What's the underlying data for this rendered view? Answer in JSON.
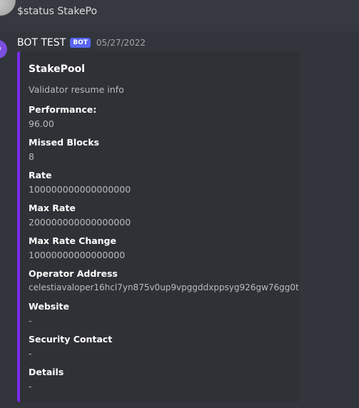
{
  "prev_message": {
    "text": "$status StakePo"
  },
  "message": {
    "username": "BOT TEST",
    "bot_tag": "BOT",
    "timestamp": "05/27/2022",
    "embed": {
      "accent_color": "#7a2cf0",
      "title": "StakePool",
      "description": "Validator resume info",
      "fields": [
        {
          "name": "Performance:",
          "value": "96.00"
        },
        {
          "name": "Missed Blocks",
          "value": "8"
        },
        {
          "name": "Rate",
          "value": "100000000000000000"
        },
        {
          "name": "Max Rate",
          "value": "200000000000000000"
        },
        {
          "name": "Max Rate Change",
          "value": "10000000000000000"
        },
        {
          "name": "Operator Address",
          "value": "celestiavaloper16hcl7yn875v0up9vpggddxppsyg926gw76gg0t"
        },
        {
          "name": "Website",
          "value": "-"
        },
        {
          "name": "Security Contact",
          "value": "-"
        },
        {
          "name": "Details",
          "value": "-"
        }
      ]
    }
  }
}
